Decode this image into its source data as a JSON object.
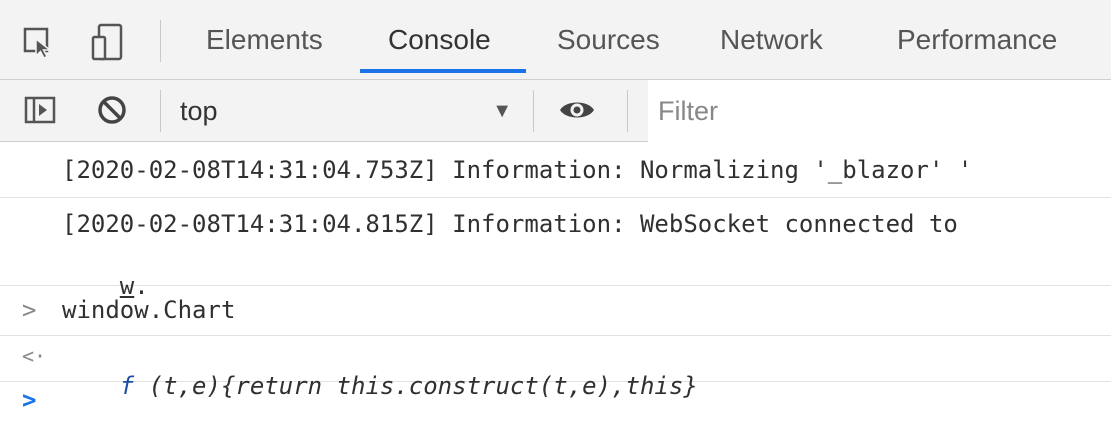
{
  "tabs": [
    {
      "label": "Elements"
    },
    {
      "label": "Console"
    },
    {
      "label": "Sources"
    },
    {
      "label": "Network"
    },
    {
      "label": "Performance"
    }
  ],
  "toolbar": {
    "context_value": "top",
    "filter_placeholder": "Filter"
  },
  "console": {
    "messages": [
      {
        "text": "[2020-02-08T14:31:04.753Z] Information: Normalizing '_blazor' '"
      },
      {
        "text": "[2020-02-08T14:31:04.815Z] Information: WebSocket connected to",
        "cont_link": "w",
        "cont_rest": "."
      }
    ],
    "input": {
      "text": "window.Chart"
    },
    "result": {
      "f": "f",
      "body": " (t,e){return this.construct(t,e),this}"
    }
  },
  "colors": {
    "accent": "#1a73e8",
    "prompt_active": "#1a73e8"
  },
  "icons": [
    "inspect-element-icon",
    "device-toolbar-icon",
    "sidebar-toggle-icon",
    "clear-console-icon",
    "live-expression-eye-icon"
  ]
}
